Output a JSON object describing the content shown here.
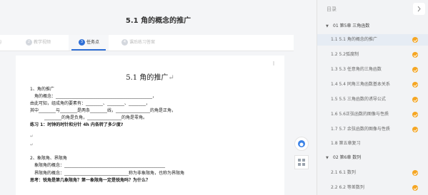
{
  "header": {
    "title": "5.1 角的概念的推广"
  },
  "tabs": [
    {
      "label": "构",
      "num": ""
    },
    {
      "label": "教学视频",
      "num": "2"
    },
    {
      "label": "任务点",
      "num": "3"
    },
    {
      "label": "课后练习答案",
      "num": "4"
    }
  ],
  "document": {
    "heading": "5.1 角的推广",
    "lines": [
      "1、角的推广",
      "角的概念：_____________________________________________，",
      "由此可知，组成角的要素有：________、________、________，",
      "其中________与________是两条________线，________________的角是正角，",
      "________的角是负角，________________的角是零角。",
      "练习 1：时钟的时针和分针 4h 内各转了多少度?",
      "",
      "",
      "2、象限角、界限角",
      "象限角的概念：_______________________________________________",
      "界限角的概念：______________________________称为非象限角，也称为界限角",
      "思考：锐角是第几象限角？第一象限角一定是锐角吗？为什么？"
    ]
  },
  "toc": {
    "title": "目录",
    "close_icon": "chevron-right-icon",
    "chapters": [
      {
        "label": "01 第5章 三角函数",
        "items": [
          {
            "label": "1.1 5.1 角的概念的推广",
            "selected": true
          },
          {
            "label": "1.2 5.2弧度制"
          },
          {
            "label": "1.3 5.3 任意角的三角函数"
          },
          {
            "label": "1.4 5.4 同角三角函数基本关系"
          },
          {
            "label": "1.5 5.5 三角函数的诱导公式"
          },
          {
            "label": "1.6 5.6正弦函数的图像与性质"
          },
          {
            "label": "1.7 5.7 余弦函数的图像与性质"
          },
          {
            "label": "1.8 第五章复习"
          }
        ]
      },
      {
        "label": "02 第6章 数列",
        "items": [
          {
            "label": "2.1 6.1 数列"
          },
          {
            "label": "2.2 6.2 等差数列"
          }
        ]
      }
    ]
  },
  "colors": {
    "accent": "#2f6fd6",
    "badge": "#f5a623"
  }
}
